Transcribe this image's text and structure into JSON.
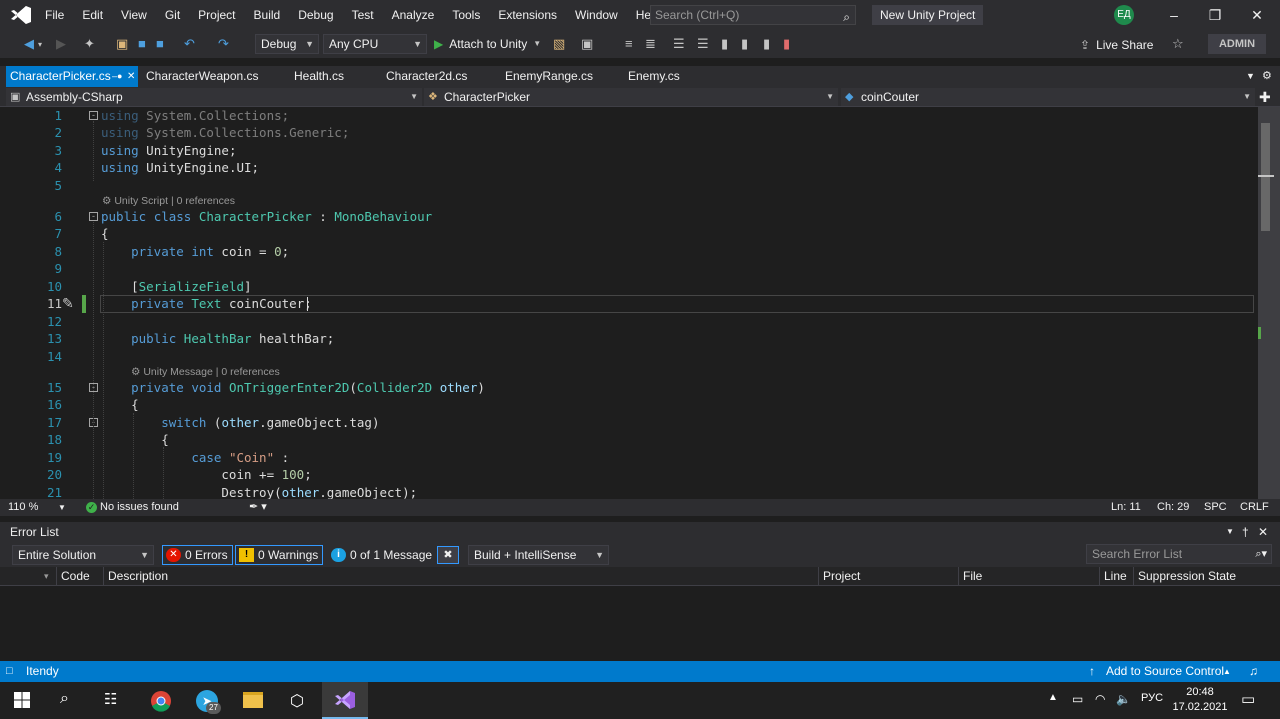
{
  "menubar": {
    "items": [
      "File",
      "Edit",
      "View",
      "Git",
      "Project",
      "Build",
      "Debug",
      "Test",
      "Analyze",
      "Tools",
      "Extensions",
      "Window",
      "Help"
    ],
    "search_placeholder": "Search (Ctrl+Q)",
    "project_name": "New Unity Project",
    "avatar_initials": "ЕД"
  },
  "toolbar": {
    "config": "Debug",
    "platform": "Any CPU",
    "attach_label": "Attach to Unity",
    "live_share": "Live Share",
    "admin": "ADMIN"
  },
  "tabs": [
    "CharacterPicker.cs",
    "CharacterWeapon.cs",
    "Health.cs",
    "Character2d.cs",
    "EnemyRange.cs",
    "Enemy.cs"
  ],
  "navbar": {
    "project": "Assembly-CSharp",
    "class": "CharacterPicker",
    "member": "coinCouter"
  },
  "code": {
    "lens_unity_script": "Unity Script | 0 references",
    "lens_unity_message": "Unity Message | 0 references",
    "line_numbers": [
      "1",
      "2",
      "3",
      "4",
      "5",
      "6",
      "7",
      "8",
      "9",
      "10",
      "11",
      "12",
      "13",
      "14",
      "15",
      "16",
      "17",
      "18",
      "19",
      "20",
      "21"
    ]
  },
  "editor_status": {
    "zoom": "110 %",
    "issues": "No issues found",
    "ln": "Ln: 11",
    "ch": "Ch: 29",
    "spc": "SPC",
    "crlf": "CRLF"
  },
  "error_list": {
    "title": "Error List",
    "scope": "Entire Solution",
    "errors": "0 Errors",
    "warnings": "0 Warnings",
    "messages": "0 of 1 Message",
    "build_filter": "Build + IntelliSense",
    "search_placeholder": "Search Error List",
    "columns": [
      "Code",
      "Description",
      "Project",
      "File",
      "Line",
      "Suppression State"
    ]
  },
  "statusbar": {
    "state": "Itendy",
    "source_control": "Add to Source Control"
  },
  "taskbar": {
    "lang": "РУС",
    "time": "20:48",
    "date": "17.02.2021",
    "telegram_badge": "27"
  },
  "colors": {
    "accent": "#007acc",
    "keyword": "#569cd6",
    "type": "#4ec9b0",
    "string": "#d69d85"
  }
}
